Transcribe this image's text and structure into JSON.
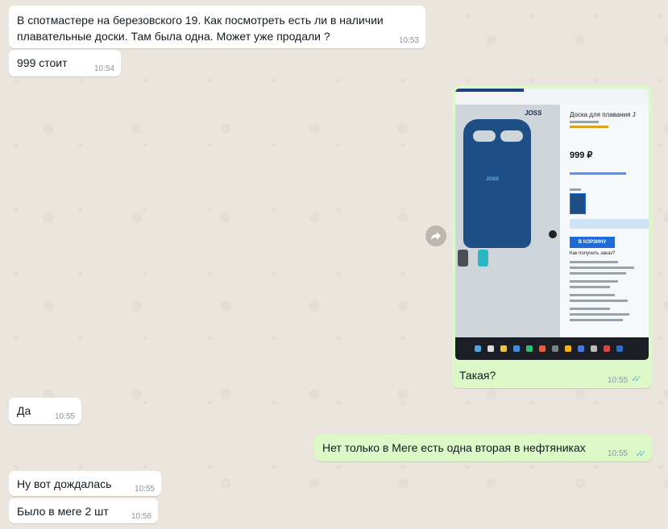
{
  "messages": [
    {
      "text_line1": "В спотмастере на березовского 19. Как посмотреть есть ли в наличии",
      "text_line2": "плавательные доски. Там была одна. Может уже продали ?",
      "time": "10:53"
    },
    {
      "text": "999  стоит",
      "time": "10:54"
    },
    {
      "caption": "Такая?",
      "time": "10:55",
      "status": "read"
    },
    {
      "text": "Да",
      "time": "10:55"
    },
    {
      "text": "Нет только в Меге есть одна вторая в нефтяниках",
      "time": "10:55",
      "status": "read"
    },
    {
      "text": "Ну вот дождалась",
      "time": "10:55"
    },
    {
      "text": "Было в меге 2 шт",
      "time": "10:56"
    }
  ],
  "photo": {
    "brand": "JOSS",
    "title": "Доска для плавания J",
    "price": "999 ₽",
    "cart_button": "В КОРЗИНУ",
    "delivery_heading": "Как получить заказ?",
    "board_logo": "JOSS"
  },
  "icons": {
    "forward": "forward-arrow-icon",
    "ticks": "double-check-icon",
    "zoom": "zoom-icon"
  },
  "colors": {
    "incoming": "#ffffff",
    "outgoing": "#dcf8c6",
    "read_ticks": "#53bdeb",
    "background": "#ece5dd"
  }
}
